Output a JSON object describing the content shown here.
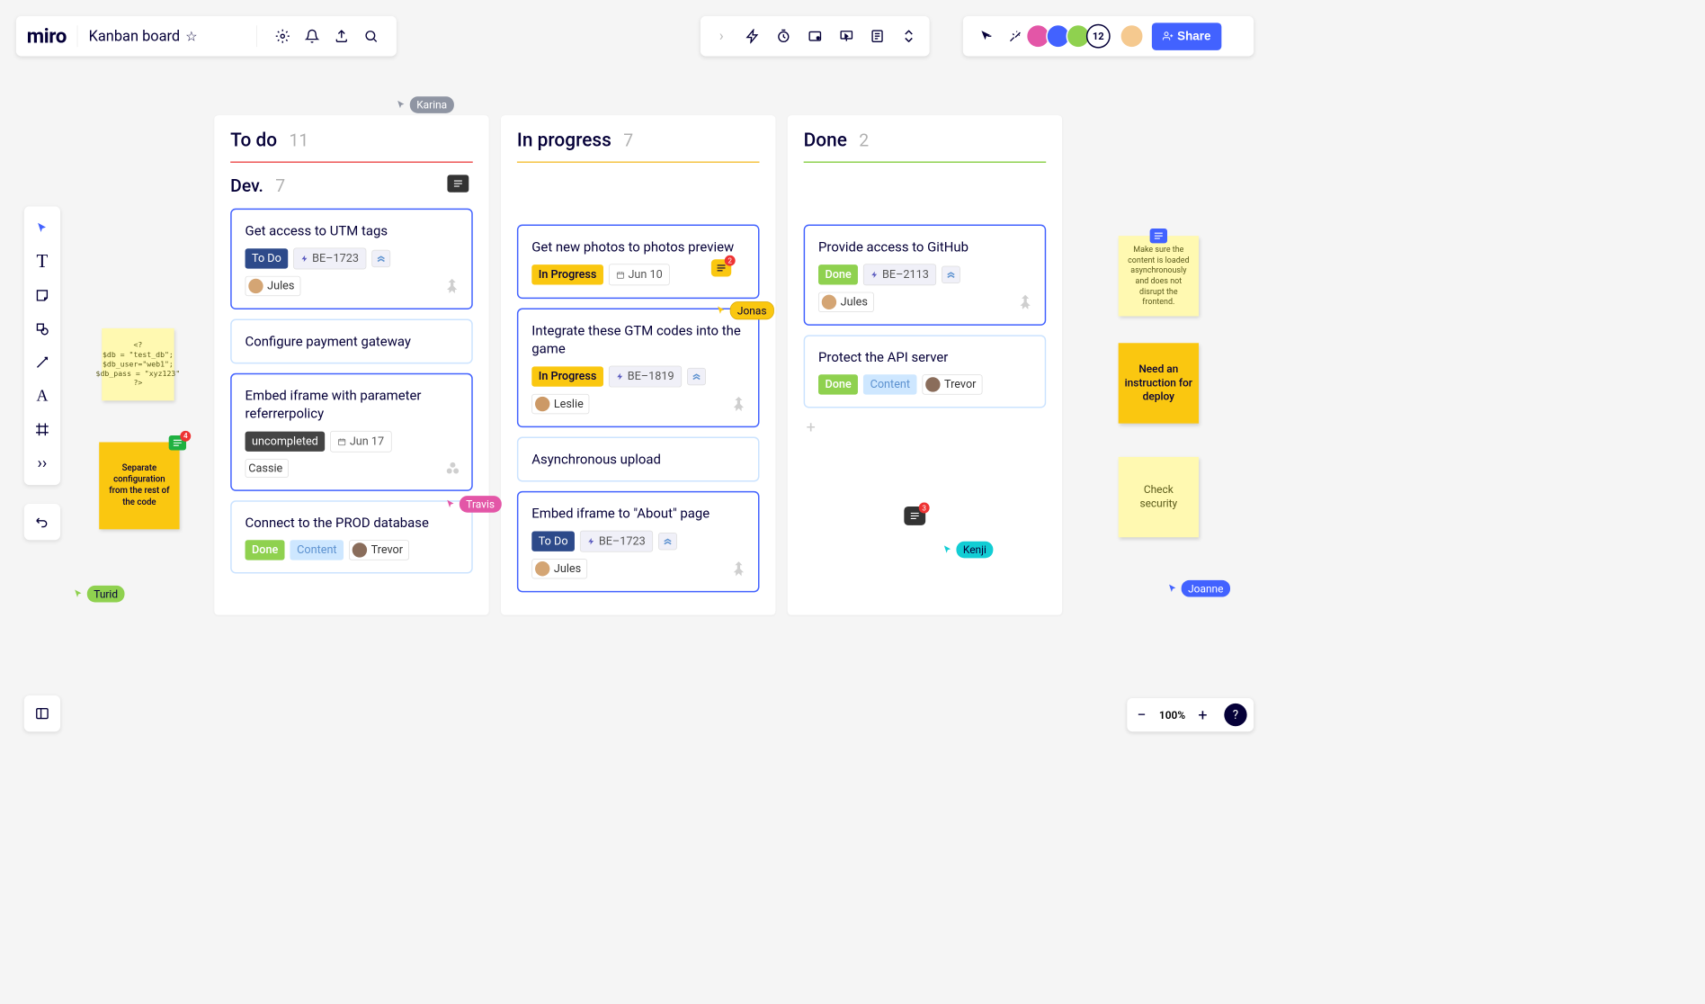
{
  "header": {
    "logo": "miro",
    "board_title": "Kanban board",
    "avatar_overflow": "12",
    "share_label": "Share"
  },
  "columns": {
    "todo": {
      "title": "To do",
      "count": "11",
      "subtitle": "Dev.",
      "subcount": "7"
    },
    "inprogress": {
      "title": "In progress",
      "count": "7"
    },
    "done": {
      "title": "Done",
      "count": "2"
    }
  },
  "cards": {
    "todo1": {
      "title": "Get access to UTM tags",
      "status": "To Do",
      "code": "BE–1723",
      "user": "Jules"
    },
    "todo2": {
      "title": "Configure payment gateway"
    },
    "todo3": {
      "title": "Embed iframe with parameter referrerpolicy",
      "status": "uncompleted",
      "date": "Jun 17",
      "user": "Cassie"
    },
    "todo4": {
      "title": "Connect to the PROD database",
      "status": "Done",
      "tag2": "Content",
      "user": "Trevor"
    },
    "ip1": {
      "title": "Get new photos to photos preview",
      "status": "In Progress",
      "date": "Jun 10",
      "badge": "2"
    },
    "ip2": {
      "title": "Integrate these GTM codes into the game",
      "status": "In Progress",
      "code": "BE–1819",
      "user": "Leslie"
    },
    "ip3": {
      "title": "Asynchronous upload"
    },
    "ip4": {
      "title": "Embed iframe to \"About\" page",
      "status": "To Do",
      "code": "BE–1723",
      "user": "Jules"
    },
    "done1": {
      "title": "Provide access to GitHub",
      "status": "Done",
      "code": "BE–2113",
      "user": "Jules"
    },
    "done2": {
      "title": "Protect the API server",
      "status": "Done",
      "tag2": "Content",
      "user": "Trevor"
    }
  },
  "stickies": {
    "code": "<?\n$db = \"test_db\";\n$db_user=\"web1\";\n$db_pass = \"xyz123\"\n?>",
    "separate": "Separate configuration from the rest of the code",
    "separate_badge": "4",
    "async": "Make sure the content is loaded asynchronously and does not disrupt the frontend.",
    "deploy": "Need an instruction for deploy",
    "security": "Check security"
  },
  "cursors": {
    "karina": "Karina",
    "turid": "Turid",
    "travis": "Travis",
    "jonas": "Jonas",
    "kenji": "Kenji",
    "joanne": "Joanne"
  },
  "float_comment_badge": "3",
  "zoom": {
    "value": "100%",
    "help": "?"
  }
}
